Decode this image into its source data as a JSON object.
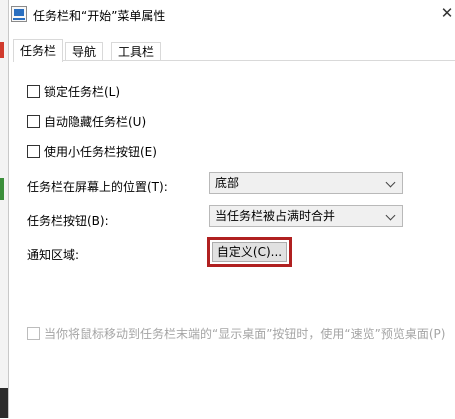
{
  "window": {
    "title": "任务栏和“开始”菜单属性",
    "close_glyph": "✕"
  },
  "tabs": [
    {
      "label": "任务栏",
      "active": true
    },
    {
      "label": "导航",
      "active": false
    },
    {
      "label": "工具栏",
      "active": false
    }
  ],
  "options": {
    "lock_taskbar": {
      "label": "锁定任务栏(L)",
      "checked": false
    },
    "auto_hide": {
      "label": "自动隐藏任务栏(U)",
      "checked": false
    },
    "small_buttons": {
      "label": "使用小任务栏按钮(E)",
      "checked": false
    }
  },
  "location": {
    "label": "任务栏在屏幕上的位置(T):",
    "value": "底部"
  },
  "buttons_mode": {
    "label": "任务栏按钮(B):",
    "value": "当任务栏被占满时合并"
  },
  "notification": {
    "label": "通知区域:",
    "button_label": "自定义(C)...",
    "highlight_color": "#b02020"
  },
  "peek": {
    "label": "当你将鼠标移动到任务栏末端的“显示桌面”按钮时，使用“速览”预览桌面(P)",
    "checked": false,
    "disabled": true
  },
  "icons": {
    "title_icon": "taskbar-properties-icon",
    "close_icon": "close-icon",
    "dropdown_icon": "chevron-down-icon"
  }
}
